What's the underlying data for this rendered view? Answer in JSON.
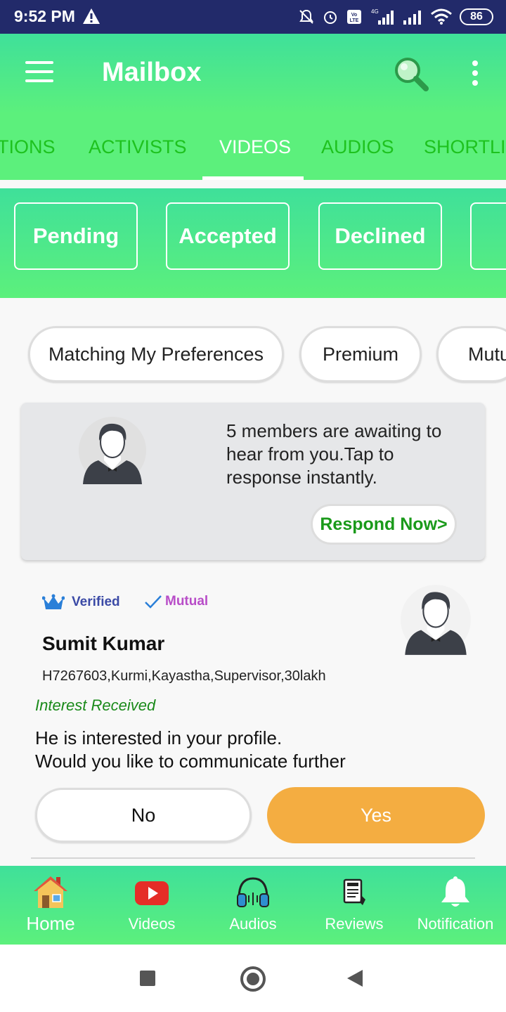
{
  "status_bar": {
    "time": "9:52 PM",
    "battery": "86",
    "network": "4G",
    "icons": [
      "warning-icon",
      "bell-off-icon",
      "alarm-icon",
      "volte-icon",
      "signal-icon",
      "signal-icon",
      "wifi-icon",
      "battery-icon"
    ]
  },
  "app_bar": {
    "title": "Mailbox",
    "icons": [
      "menu-icon",
      "search-icon",
      "more-vert-icon"
    ]
  },
  "tabs": [
    {
      "label": "TIONS",
      "active": false
    },
    {
      "label": "ACTIVISTS",
      "active": false
    },
    {
      "label": "VIDEOS",
      "active": true
    },
    {
      "label": "AUDIOS",
      "active": false
    },
    {
      "label": "SHORTLIS",
      "active": false
    }
  ],
  "sub_filters": [
    {
      "label": "Pending"
    },
    {
      "label": "Accepted"
    },
    {
      "label": "Declined"
    },
    {
      "label": ""
    }
  ],
  "pill_filters": [
    {
      "label": "Matching My Preferences"
    },
    {
      "label": "Premium"
    },
    {
      "label": "Mutu"
    }
  ],
  "awaiting_card": {
    "message": "5 members are awaiting to hear from you.Tap to response instantly.",
    "button_label": "Respond Now>",
    "avatar_icon": "person-avatar-icon"
  },
  "profile": {
    "verified_label": "Verified",
    "mutual_label": "Mutual",
    "name": "Sumit Kumar",
    "details": "H7267603,Kurmi,Kayastha,Supervisor,30lakh",
    "status": "Interest Received",
    "message_line1": "He is interested in your profile.",
    "message_line2": "Would you like to communicate further",
    "no_label": "No",
    "yes_label": "Yes"
  },
  "bottom_nav": [
    {
      "label": "Home",
      "icon": "home-icon"
    },
    {
      "label": "Videos",
      "icon": "youtube-icon"
    },
    {
      "label": "Audios",
      "icon": "headphones-icon"
    },
    {
      "label": "Reviews",
      "icon": "news-icon"
    },
    {
      "label": "Notification",
      "icon": "bell-icon"
    }
  ],
  "colors": {
    "status_bar": "#222a6a",
    "brand_green": "#5cf07c",
    "brand_teal": "#3fe09a",
    "tab_inactive": "#1ec21e",
    "accent_orange": "#f4ad41",
    "interest_green": "#1a8a1a"
  }
}
